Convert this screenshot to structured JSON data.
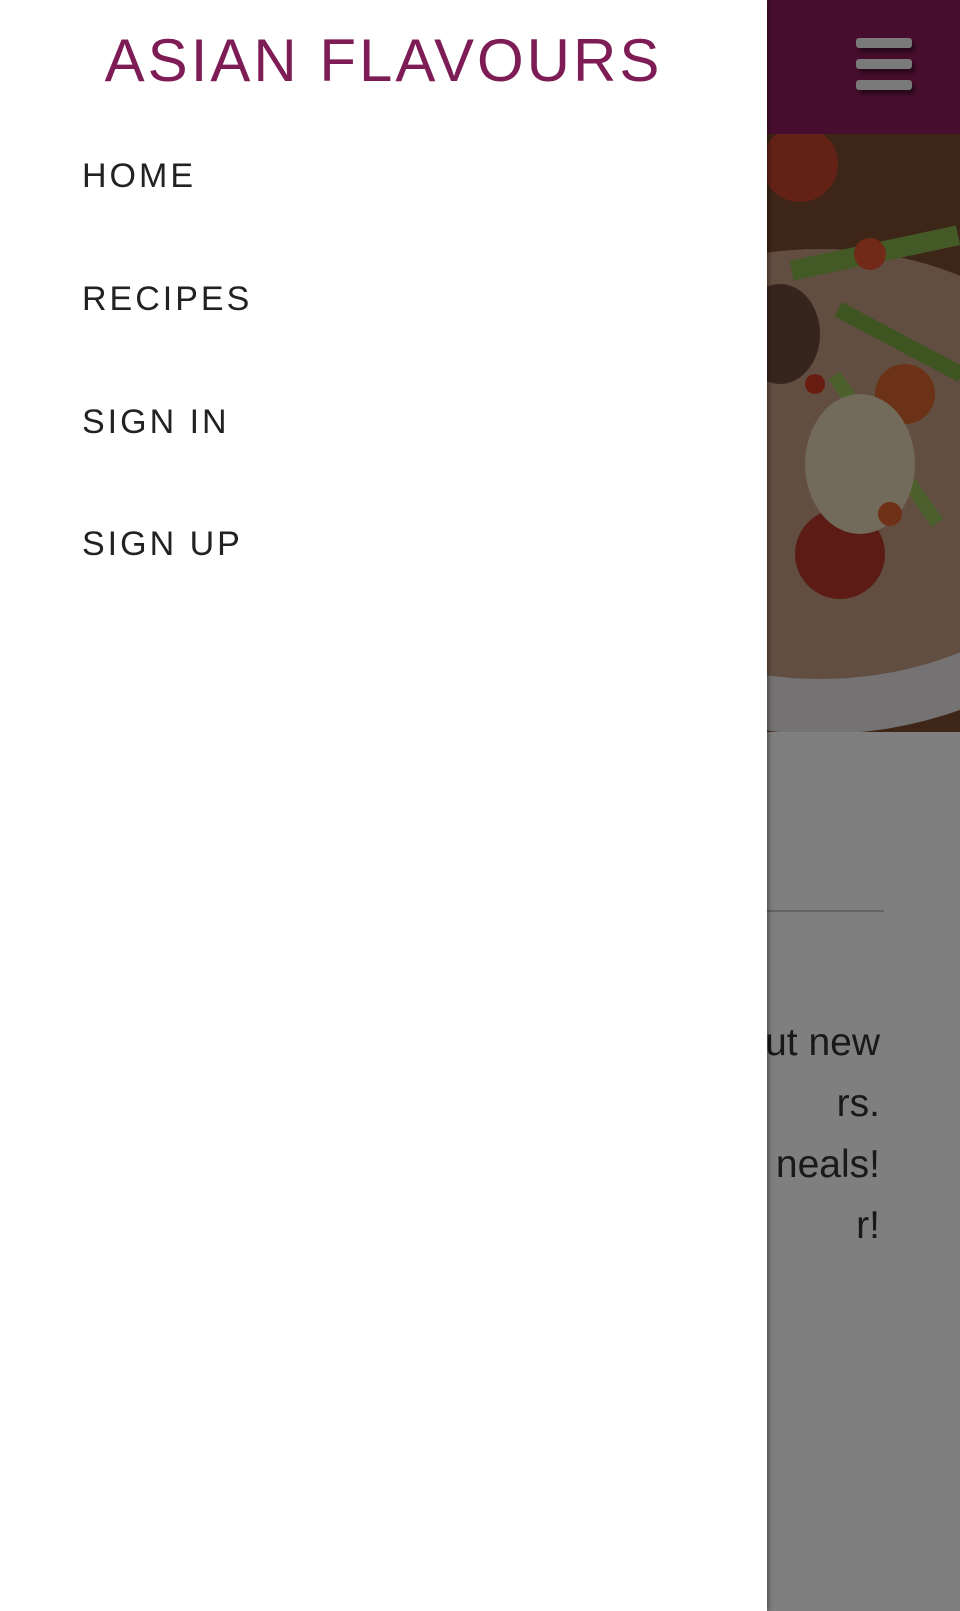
{
  "drawer": {
    "brand": "ASIAN FLAVOURS",
    "items": [
      {
        "label": "HOME"
      },
      {
        "label": "RECIPES"
      },
      {
        "label": "SIGN IN"
      },
      {
        "label": "SIGN UP"
      }
    ]
  },
  "page": {
    "intro_lines": [
      "ut new",
      "rs.",
      "neals!",
      "r!"
    ]
  },
  "icons": {
    "menu": "hamburger-menu-icon"
  },
  "colors": {
    "brand": "#7d1c55",
    "topbar": "#8e1b5c",
    "drawer_bg": "#ffffff",
    "nav_text": "#222222"
  }
}
